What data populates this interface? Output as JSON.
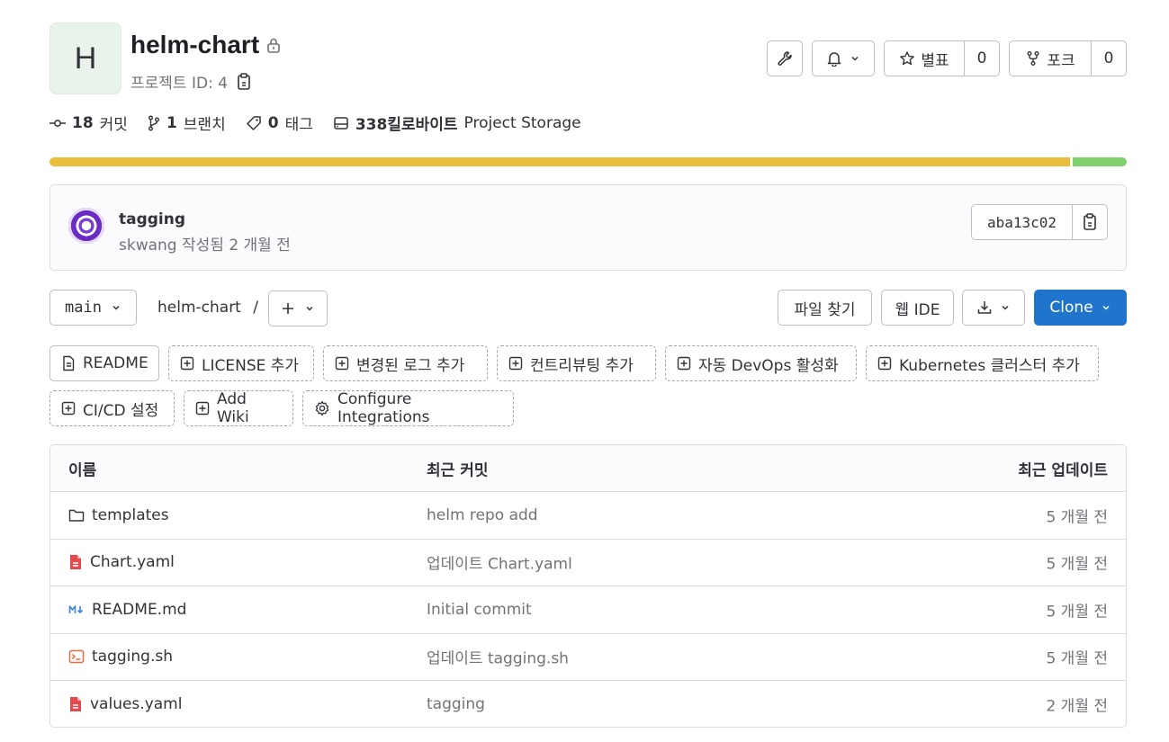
{
  "project": {
    "avatar_letter": "H",
    "name": "helm-chart",
    "id_label": "프로젝트 ID: 4"
  },
  "header_actions": {
    "star_label": "별표",
    "star_count": "0",
    "fork_label": "포크",
    "fork_count": "0"
  },
  "stats": {
    "commits_count": "18",
    "commits_label": "커밋",
    "branches_count": "1",
    "branches_label": "브랜치",
    "tags_count": "0",
    "tags_label": "태그",
    "storage_size": "338킬로바이트",
    "storage_label": "Project Storage"
  },
  "storage_usage": {
    "primary_fraction": 0.95,
    "primary_color": "#e9be3c",
    "secondary_color": "#7ed16b"
  },
  "last_commit": {
    "title": "tagging",
    "meta": "skwang 작성됨 2 개월 전",
    "sha": "aba13c02"
  },
  "toolbar": {
    "branch": "main",
    "breadcrumb_project": "helm-chart",
    "breadcrumb_sep": "/",
    "find_file": "파일 찾기",
    "web_ide": "웹 IDE",
    "clone": "Clone"
  },
  "shortcuts": [
    {
      "label": "README"
    },
    {
      "label": "LICENSE 추가"
    },
    {
      "label": "변경된 로그 추가"
    },
    {
      "label": "컨트리뷰팅 추가"
    },
    {
      "label": "자동 DevOps 활성화"
    },
    {
      "label": "Kubernetes 클러스터 추가"
    },
    {
      "label": "CI/CD 설정"
    },
    {
      "label": "Add Wiki"
    },
    {
      "label": "Configure Integrations"
    }
  ],
  "file_table": {
    "headers": {
      "name": "이름",
      "last_commit": "최근 커밋",
      "last_update": "최근 업데이트"
    },
    "rows": [
      {
        "name": "templates",
        "icon": "folder-icon",
        "commit": "helm repo add",
        "updated": "5 개월 전"
      },
      {
        "name": "Chart.yaml",
        "icon": "yaml-file-icon",
        "commit": "업데이트 Chart.yaml",
        "updated": "5 개월 전"
      },
      {
        "name": "README.md",
        "icon": "markdown-file-icon",
        "commit": "Initial commit",
        "updated": "5 개월 전"
      },
      {
        "name": "tagging.sh",
        "icon": "shell-file-icon",
        "commit": "업데이트 tagging.sh",
        "updated": "5 개월 전"
      },
      {
        "name": "values.yaml",
        "icon": "yaml-file-icon",
        "commit": "tagging",
        "updated": "2 개월 전"
      }
    ]
  }
}
